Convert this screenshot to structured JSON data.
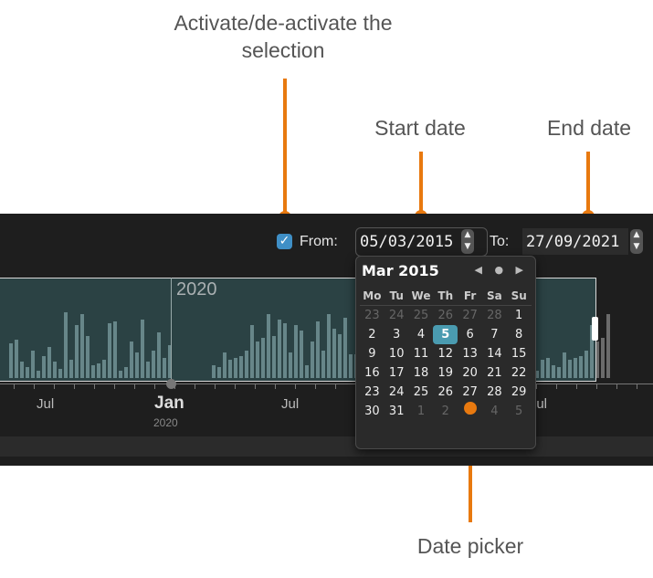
{
  "annotations": {
    "toggle": "Activate/de-activate the\nselection",
    "start": "Start date",
    "end": "End date",
    "picker": "Date picker"
  },
  "controls": {
    "checkbox_checked": true,
    "from_label": "From:",
    "start_value": "05/03/2015",
    "to_label": "To:",
    "end_value": "27/09/2021"
  },
  "timeline": {
    "selection_year_label": "2020",
    "axis": [
      {
        "label": "Jul",
        "sub": ""
      },
      {
        "label": "Jan",
        "sub": "2020"
      },
      {
        "label": "Jul",
        "sub": ""
      },
      {
        "label": "Jul",
        "sub": ""
      }
    ]
  },
  "picker": {
    "month_label": "Mar 2015",
    "nav": "◀ ● ▶",
    "weekdays": [
      "Mo",
      "Tu",
      "We",
      "Th",
      "Fr",
      "Sa",
      "Su"
    ],
    "weeks": [
      [
        {
          "d": "23",
          "dim": true
        },
        {
          "d": "24",
          "dim": true
        },
        {
          "d": "25",
          "dim": true
        },
        {
          "d": "26",
          "dim": true
        },
        {
          "d": "27",
          "dim": true
        },
        {
          "d": "28",
          "dim": true
        },
        {
          "d": "1"
        }
      ],
      [
        {
          "d": "2"
        },
        {
          "d": "3"
        },
        {
          "d": "4"
        },
        {
          "d": "5",
          "selected": true
        },
        {
          "d": "6"
        },
        {
          "d": "7"
        },
        {
          "d": "8"
        }
      ],
      [
        {
          "d": "9"
        },
        {
          "d": "10"
        },
        {
          "d": "11"
        },
        {
          "d": "12"
        },
        {
          "d": "13"
        },
        {
          "d": "14"
        },
        {
          "d": "15"
        }
      ],
      [
        {
          "d": "16"
        },
        {
          "d": "17"
        },
        {
          "d": "18"
        },
        {
          "d": "19"
        },
        {
          "d": "20"
        },
        {
          "d": "21"
        },
        {
          "d": "22"
        }
      ],
      [
        {
          "d": "23"
        },
        {
          "d": "24"
        },
        {
          "d": "25"
        },
        {
          "d": "26"
        },
        {
          "d": "27"
        },
        {
          "d": "28"
        },
        {
          "d": "29"
        }
      ],
      [
        {
          "d": "30"
        },
        {
          "d": "31"
        },
        {
          "d": "1",
          "dim": true
        },
        {
          "d": "2",
          "dim": true
        },
        {
          "d": "3",
          "dim": true
        },
        {
          "d": "4",
          "dim": true
        },
        {
          "d": "5",
          "dim": true
        }
      ]
    ]
  },
  "colors": {
    "accent": "#e8790f",
    "checkbox": "#3f8fc6",
    "selected_day": "#4a9bb0"
  }
}
